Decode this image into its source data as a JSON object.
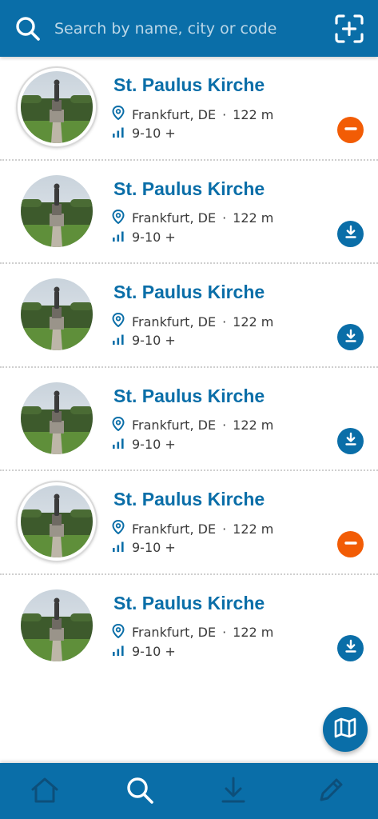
{
  "search": {
    "placeholder": "Search by name, city or code"
  },
  "colors": {
    "primary": "#0a6ea8",
    "remove": "#f25c05",
    "text": "#3a3a3a"
  },
  "icons": {
    "search": "search-icon",
    "scan": "scan-add-icon",
    "location": "location-pin-icon",
    "difficulty": "signal-bars-icon",
    "remove": "minus-icon",
    "download": "download-icon",
    "map": "map-icon"
  },
  "items": [
    {
      "title": "St. Paulus Kirche",
      "location": "Frankfurt, DE",
      "distance": "122 m",
      "difficulty": "9-10 +",
      "action": "remove"
    },
    {
      "title": "St. Paulus Kirche",
      "location": "Frankfurt, DE",
      "distance": "122 m",
      "difficulty": "9-10 +",
      "action": "download"
    },
    {
      "title": "St. Paulus Kirche",
      "location": "Frankfurt, DE",
      "distance": "122 m",
      "difficulty": "9-10 +",
      "action": "download"
    },
    {
      "title": "St. Paulus Kirche",
      "location": "Frankfurt, DE",
      "distance": "122 m",
      "difficulty": "9-10 +",
      "action": "download"
    },
    {
      "title": "St. Paulus Kirche",
      "location": "Frankfurt, DE",
      "distance": "122 m",
      "difficulty": "9-10 +",
      "action": "remove"
    },
    {
      "title": "St. Paulus Kirche",
      "location": "Frankfurt, DE",
      "distance": "122 m",
      "difficulty": "9-10 +",
      "action": "download"
    }
  ],
  "bottom_nav": [
    "home-icon",
    "search-icon",
    "download-icon",
    "pencil-icon"
  ],
  "bottom_nav_active": 1
}
